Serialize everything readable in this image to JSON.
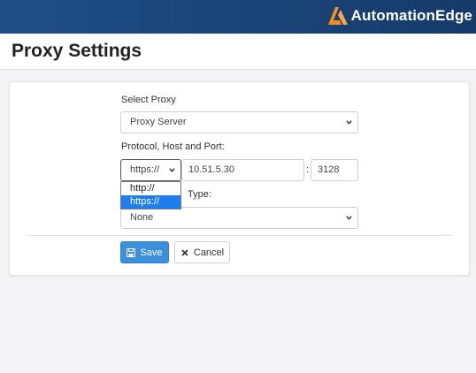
{
  "brand": {
    "name": "AutomationEdge"
  },
  "page": {
    "title": "Proxy Settings"
  },
  "form": {
    "select_proxy_label": "Select Proxy",
    "proxy_value": "Proxy Server",
    "protocol_label": "Protocol, Host and Port:",
    "protocol_value": "https://",
    "host_value": "10.51.5.30",
    "port_separator": ":",
    "port_value": "3128",
    "auth_label_visible": "Type:",
    "auth_value": "None",
    "protocol_options": [
      "http://",
      "https://"
    ],
    "protocol_selected_index": 1
  },
  "buttons": {
    "save": "Save",
    "cancel": "Cancel"
  },
  "colors": {
    "accent": "#3b8fdd",
    "topbar": "#1a4478",
    "brand_orange": "#f28c28",
    "selected_option": "#1e7ef0"
  }
}
